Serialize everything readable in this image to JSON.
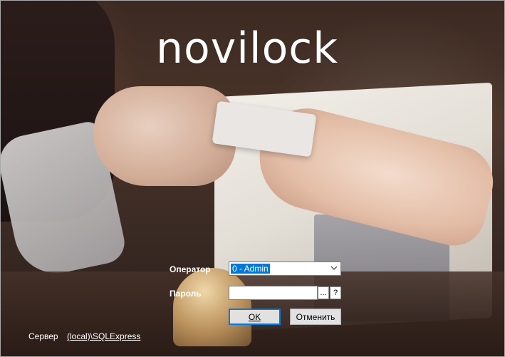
{
  "app": {
    "logo_text": "novilock"
  },
  "form": {
    "operator_label": "Оператор",
    "operator_value": "0 - Admin",
    "password_label": "Пароль",
    "password_value": "",
    "browse_label": "...",
    "help_label": "?",
    "ok_label": "OK",
    "ok_accesskey": "O",
    "cancel_label": "Отменить",
    "cancel_accesskey": "О"
  },
  "footer": {
    "server_label": "Сервер",
    "server_value": "(local)\\SQLExpress"
  },
  "colors": {
    "selection": "#0078d7",
    "text_on_photo": "#ffffff"
  }
}
